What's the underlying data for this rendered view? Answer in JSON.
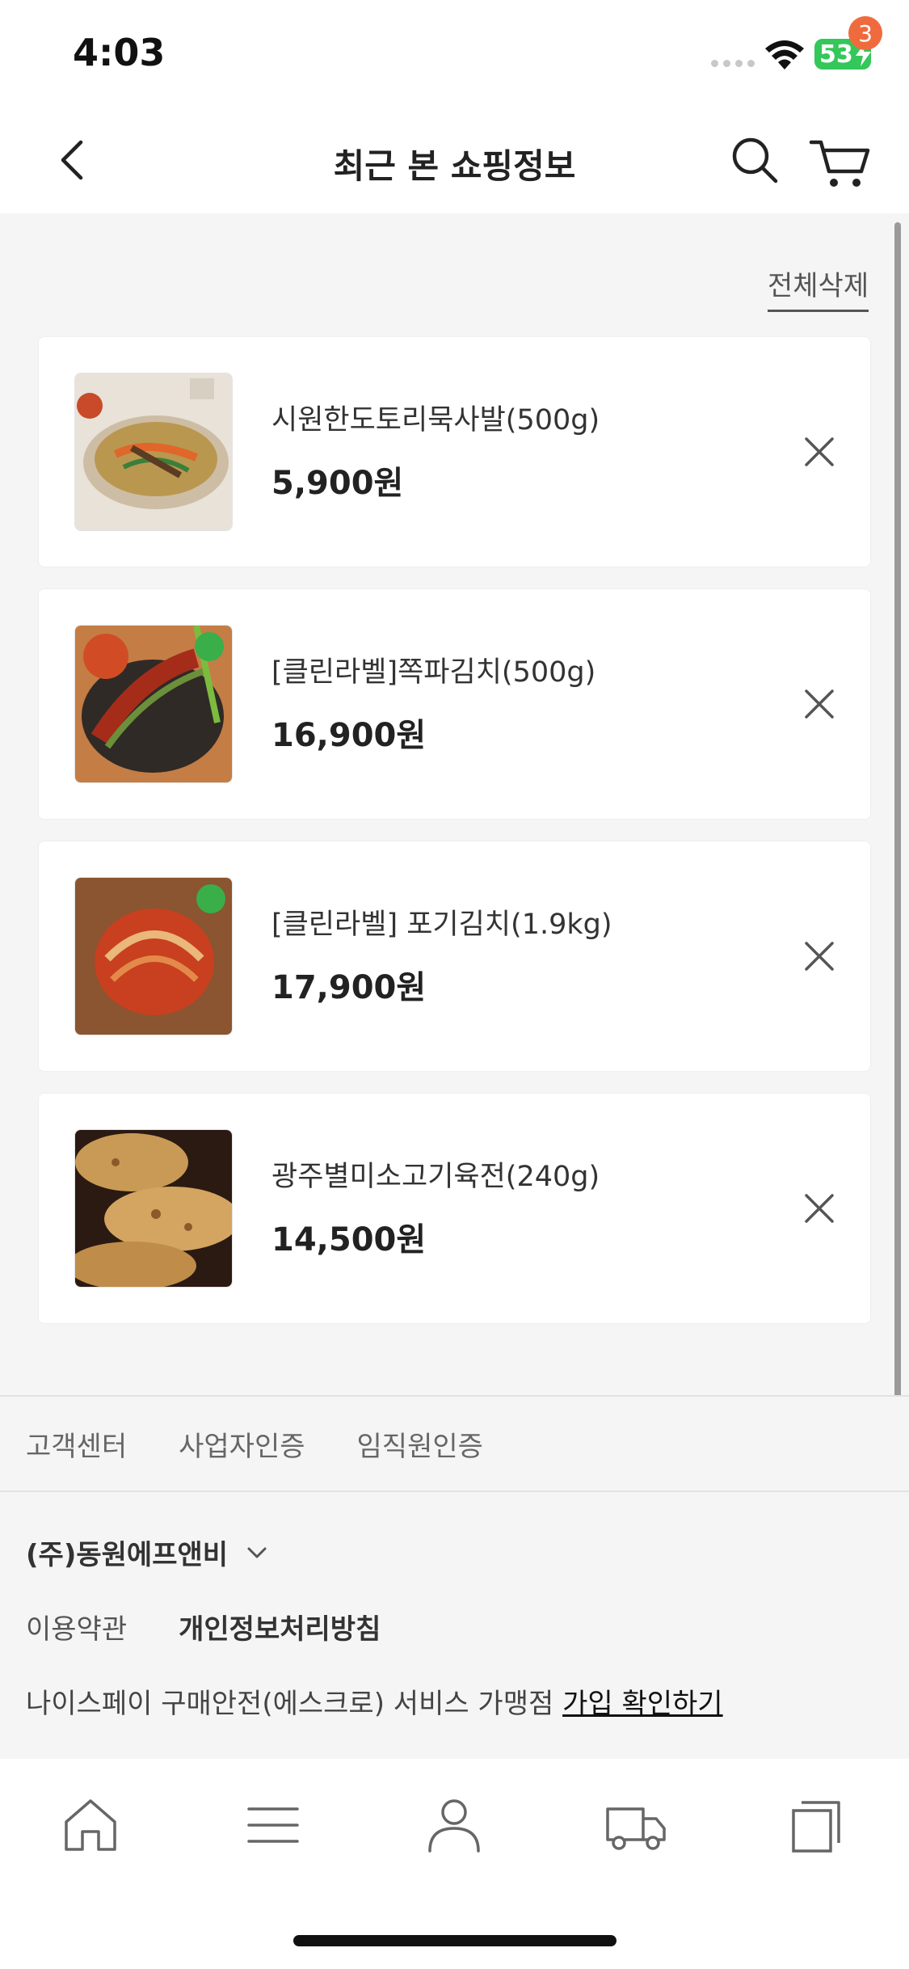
{
  "status_bar": {
    "time": "4:03",
    "battery": "53"
  },
  "header": {
    "title": "최근 본 쇼핑정보",
    "cart_count": "3"
  },
  "actions": {
    "delete_all": "전체삭제"
  },
  "items": [
    {
      "name": "시원한도토리묵사발(500g)",
      "price": "5,900원",
      "image_icon": "acorn-jelly-soup"
    },
    {
      "name": "[클린라벨]쪽파김치(500g)",
      "price": "16,900원",
      "image_icon": "green-onion-kimchi"
    },
    {
      "name": "[클린라벨] 포기김치(1.9kg)",
      "price": "17,900원",
      "image_icon": "cabbage-kimchi"
    },
    {
      "name": "광주별미소고기육전(240g)",
      "price": "14,500원",
      "image_icon": "beef-pancake"
    }
  ],
  "footer": {
    "links": [
      "고객센터",
      "사업자인증",
      "임직원인증"
    ],
    "company": "(주)동원에프앤비",
    "terms": "이용약관",
    "privacy": "개인정보처리방침",
    "escrow_text": "나이스페이 구매안전(에스크로) 서비스 가맹점",
    "escrow_link": "가입 확인하기"
  },
  "tabbar": {
    "icons": [
      "home-icon",
      "menu-icon",
      "user-icon",
      "delivery-truck-icon",
      "recent-pages-icon"
    ]
  },
  "colors": {
    "accent": "#ef6b3e",
    "background": "#f5f5f5",
    "battery": "#34c759"
  }
}
